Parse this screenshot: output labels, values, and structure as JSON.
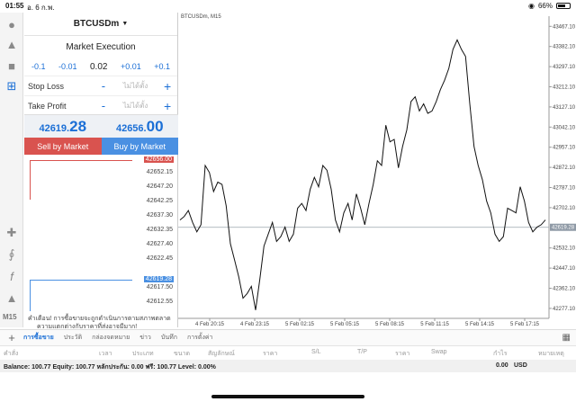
{
  "status_bar": {
    "time": "01:55",
    "date": "อ. 6 ก.พ.",
    "battery": "66%",
    "battery_level": 0.66
  },
  "toolbar": {
    "icons": [
      "user-icon",
      "user-transfer-icon",
      "chat-icon",
      "new-order-icon",
      "crosshair-icon",
      "indicators-icon",
      "function-icon",
      "objects-icon"
    ],
    "timeframe": "M15"
  },
  "order_panel": {
    "symbol": "BTCUSDm",
    "execution": "Market Execution",
    "volume": {
      "minus_large": "-0.1",
      "minus_small": "-0.01",
      "value": "0.02",
      "plus_small": "+0.01",
      "plus_large": "+0.1"
    },
    "stop_loss": {
      "label": "Stop Loss",
      "placeholder": "ไม่ได้ตั้ง"
    },
    "take_profit": {
      "label": "Take Profit",
      "placeholder": "ไม่ได้ตั้ง"
    },
    "bid": {
      "prefix": "42619.",
      "suffix": "28"
    },
    "ask": {
      "prefix": "42656.",
      "suffix": "00"
    },
    "sell_label": "Sell by Market",
    "buy_label": "Buy by Market",
    "tick_prices": [
      "42652.15",
      "42647.20",
      "42642.25",
      "42637.30",
      "42632.35",
      "42627.40",
      "42622.45",
      "42617.50",
      "42612.55"
    ],
    "ask_tag": "42656.00",
    "bid_tag": "42619.28",
    "warning_line1": "คำเตือน! การซื้อขายจะถูกดำเนินการตามสภาพตลาด",
    "warning_line2": "ความแตกต่างกับราคาที่ส่งอาจมีมาก!"
  },
  "chart": {
    "title": "BTCUSDm, M15",
    "current_price_label": "42619.28",
    "colors": {
      "line": "#111111",
      "bid_line": "#9aa3ad",
      "tag": "#8f9aa6"
    }
  },
  "chart_data": {
    "type": "line",
    "title": "BTCUSDm, M15",
    "xlabel": "",
    "ylabel": "",
    "ylim": [
      42235,
      43510
    ],
    "y_ticks": [
      43467.1,
      43382.1,
      43297.1,
      43212.1,
      43127.1,
      43042.1,
      42957.1,
      42872.1,
      42787.1,
      42702.1,
      42532.1,
      42447.1,
      42362.1,
      42277.1
    ],
    "x_ticks": [
      "4 Feb 20:15",
      "4 Feb 23:15",
      "5 Feb 02:15",
      "5 Feb 05:15",
      "5 Feb 08:15",
      "5 Feb 11:15",
      "5 Feb 14:15",
      "5 Feb 17:15"
    ],
    "current_price": 42619.28,
    "series": [
      {
        "values": [
          42650,
          42665,
          42690,
          42640,
          42600,
          42630,
          42880,
          42850,
          42770,
          42810,
          42800,
          42710,
          42550,
          42480,
          42410,
          42320,
          42340,
          42370,
          42270,
          42400,
          42540,
          42590,
          42640,
          42560,
          42580,
          42620,
          42560,
          42590,
          42700,
          42720,
          42690,
          42780,
          42830,
          42790,
          42880,
          42860,
          42780,
          42650,
          42600,
          42680,
          42720,
          42650,
          42760,
          42700,
          42630,
          42720,
          42800,
          42900,
          42880,
          43050,
          42980,
          42990,
          42870,
          42960,
          43030,
          43150,
          43170,
          43110,
          43140,
          43100,
          43110,
          43150,
          43200,
          43240,
          43290,
          43370,
          43410,
          43370,
          43340,
          43140,
          42960,
          42880,
          42820,
          42730,
          42680,
          42590,
          42560,
          42580,
          42700,
          42690,
          42680,
          42790,
          42730,
          42640,
          42600,
          42620,
          42630,
          42650
        ]
      }
    ]
  },
  "bottom_tabs": {
    "tabs": [
      "การซื้อขาย",
      "ประวัติ",
      "กล่องจดหมาย",
      "ข่าว",
      "บันทึก",
      "การตั้งค่า"
    ],
    "headers": [
      "คำสั่ง",
      "เวลา",
      "ประเภท",
      "ขนาด",
      "สัญลักษณ์",
      "ราคา",
      "S/L",
      "T/P",
      "ราคา",
      "Swap",
      "กำไร",
      "หมายเหตุ"
    ]
  },
  "balance": {
    "text": "Balance: 100.77 Equity: 100.77 หลักประกัน: 0.00 ฟรี: 100.77 Level: 0.00%",
    "profit": "0.00",
    "currency": "USD"
  }
}
